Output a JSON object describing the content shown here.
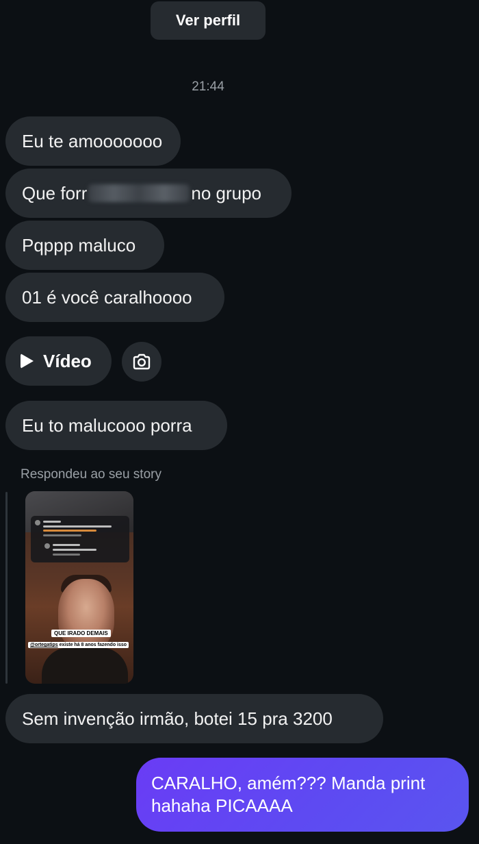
{
  "header": {
    "profile_button": "Ver perfil"
  },
  "timestamp": "21:44",
  "messages": [
    {
      "text": "Eu te amooooooo"
    },
    {
      "before": "Que forr",
      "after": "no grupo"
    },
    {
      "text": "Pqppp maluco"
    },
    {
      "text": "01 é você caralhoooo"
    }
  ],
  "video": {
    "label": "Vídeo",
    "icon": "play-icon",
    "camera_icon": "camera-icon"
  },
  "message_after_video": "Eu to malucooo porra",
  "story_reply": {
    "label": "Respondeu ao seu story",
    "caption_main": "QUE IRADO DEMAIS",
    "caption_handle": "@ortegatips",
    "caption_rest": " existe há 8 anos fazendo isso"
  },
  "message_after_story": "Sem invenção irmão, botei 15 pra 3200",
  "sent_message": {
    "line1": "CARALHO, amém??? Manda print",
    "line2": "hahaha PICAAAA"
  },
  "colors": {
    "background": "#0c1014",
    "bubble": "#262b30",
    "sent_bubble": "#5d4bf2",
    "muted": "#9aa0a6"
  }
}
